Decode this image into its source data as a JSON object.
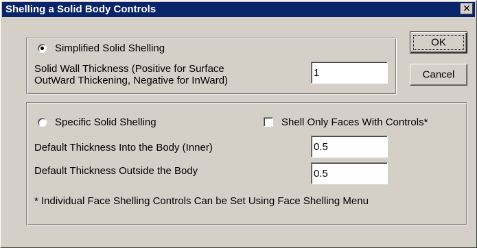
{
  "window": {
    "title": "Shelling a Solid Body Controls",
    "close_glyph": "✕"
  },
  "simplified": {
    "radio_label": "Simplified Solid Shelling",
    "radio_checked": true,
    "thickness_label_line1": "Solid Wall Thickness (Positive for Surface",
    "thickness_label_line2": "OutWard Thickening, Negative for InWard)",
    "thickness_value": "1"
  },
  "specific": {
    "radio_label": "Specific Solid Shelling",
    "radio_checked": false,
    "checkbox_label": "Shell Only Faces With Controls*",
    "checkbox_checked": false,
    "inner_label": "Default Thickness Into the Body (Inner)",
    "inner_value": "0.5",
    "outer_label": "Default Thickness Outside the Body",
    "outer_value": "0.5",
    "footnote": "* Individual Face Shelling Controls Can be Set Using Face Shelling Menu"
  },
  "buttons": {
    "ok_label": "OK",
    "cancel_label": "Cancel"
  }
}
